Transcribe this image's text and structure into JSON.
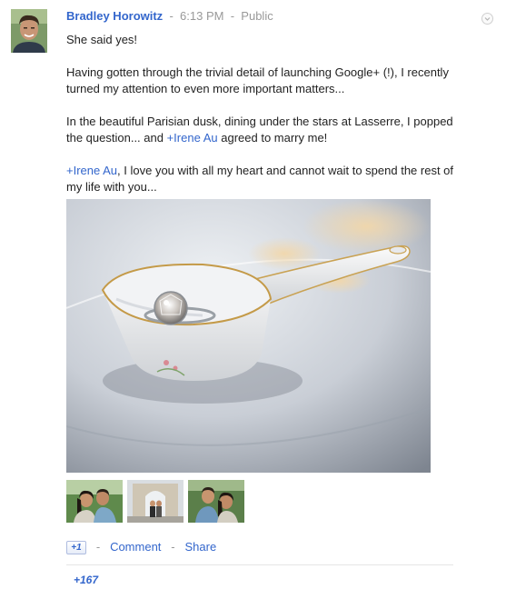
{
  "post": {
    "author": "Bradley Horowitz",
    "separator": "-",
    "time": "6:13 PM",
    "visibility": "Public",
    "paragraphs": {
      "p1": "She said yes!",
      "p2": "Having gotten through the trivial detail of launching Google+ (!), I recently turned my attention to even more important matters...",
      "p3_before": "In the beautiful Parisian dusk, dining under the stars at Lasserre, I popped the question... and ",
      "p3_mention": "+Irene Au",
      "p3_after": " agreed to marry me!",
      "p4_mention": "+Irene Au",
      "p4_after": ", I love you with all my heart and cannot wait to spend the rest of my life with you..."
    },
    "thumbnail_count": 3
  },
  "actions": {
    "plusone_label": "+1",
    "separator": "-",
    "comment_label": "Comment",
    "share_label": "Share"
  },
  "plus_count": "+167",
  "icons": {
    "menu": "chevron-down-icon",
    "plusone": "plus-one-icon"
  },
  "colors": {
    "link": "#3366cc",
    "meta": "#999999",
    "text": "#222222",
    "divider": "#e5e5e5"
  }
}
